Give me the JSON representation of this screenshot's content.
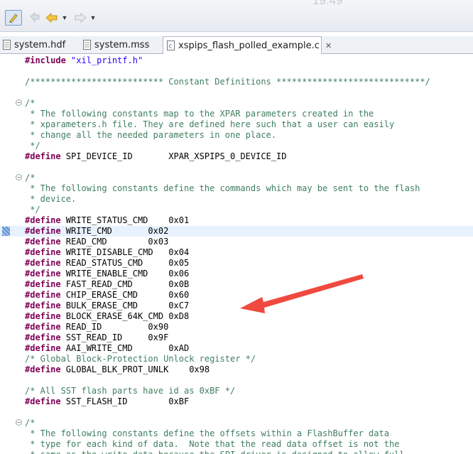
{
  "clock_text": "19:49",
  "toolbar": {
    "items": [
      {
        "icon": "pen-edit-icon",
        "pressed": true
      },
      {
        "icon": "prev-edit-location-icon"
      },
      {
        "icon": "back-arrow-icon",
        "color": "#e2a100"
      },
      {
        "icon": "dropdown-icon"
      },
      {
        "icon": "forward-arrow-icon"
      },
      {
        "icon": "dropdown-icon"
      }
    ]
  },
  "tabs": [
    {
      "label": "system.hdf",
      "icon": "file-icon",
      "active": false
    },
    {
      "label": "system.mss",
      "icon": "file-icon",
      "active": false
    },
    {
      "label": "xspips_flash_polled_example.c",
      "icon": "c-file-icon",
      "active": true,
      "close": "✕"
    }
  ],
  "code": [
    [
      {
        "t": "#include ",
        "c": "kw"
      },
      {
        "t": "\"xil_printf.h\"",
        "c": "str"
      }
    ],
    [],
    [
      {
        "t": "/************************** Constant Definitions *****************************/",
        "c": "cmt"
      }
    ],
    [],
    [
      {
        "t": "/*",
        "c": "cmt"
      }
    ],
    [
      {
        "t": " * The following constants map to the XPAR parameters created in the",
        "c": "cmt"
      }
    ],
    [
      {
        "t": " * xparameters.h file. They are defined here such that a user can easily",
        "c": "cmt"
      }
    ],
    [
      {
        "t": " * change all the needed parameters in one place.",
        "c": "cmt"
      }
    ],
    [
      {
        "t": " */",
        "c": "cmt"
      }
    ],
    [
      {
        "t": "#define ",
        "c": "kw"
      },
      {
        "t": "SPI_DEVICE_ID       XPAR_XSPIPS_0_DEVICE_ID"
      }
    ],
    [],
    [
      {
        "t": "/*",
        "c": "cmt"
      }
    ],
    [
      {
        "t": " * The following constants define the commands which may be sent to the flash",
        "c": "cmt"
      }
    ],
    [
      {
        "t": " * device.",
        "c": "cmt"
      }
    ],
    [
      {
        "t": " */",
        "c": "cmt"
      }
    ],
    [
      {
        "t": "#define ",
        "c": "kw"
      },
      {
        "t": "WRITE_STATUS_CMD    0x01"
      }
    ],
    [
      {
        "t": "#define ",
        "c": "kw"
      },
      {
        "t": "WRITE_CMD       0x02"
      }
    ],
    [
      {
        "t": "#define ",
        "c": "kw"
      },
      {
        "t": "READ_CMD        0x03"
      }
    ],
    [
      {
        "t": "#define ",
        "c": "kw"
      },
      {
        "t": "WRITE_DISABLE_CMD   0x04"
      }
    ],
    [
      {
        "t": "#define ",
        "c": "kw"
      },
      {
        "t": "READ_STATUS_CMD     0x05"
      }
    ],
    [
      {
        "t": "#define ",
        "c": "kw"
      },
      {
        "t": "WRITE_ENABLE_CMD    0x06"
      }
    ],
    [
      {
        "t": "#define ",
        "c": "kw"
      },
      {
        "t": "FAST_READ_CMD       0x0B"
      }
    ],
    [
      {
        "t": "#define ",
        "c": "kw"
      },
      {
        "t": "CHIP_ERASE_CMD      0x60"
      }
    ],
    [
      {
        "t": "#define ",
        "c": "kw"
      },
      {
        "t": "BULK_ERASE_CMD      0xC7"
      }
    ],
    [
      {
        "t": "#define ",
        "c": "kw"
      },
      {
        "t": "BLOCK_ERASE_64K_CMD 0xD8"
      }
    ],
    [
      {
        "t": "#define ",
        "c": "kw"
      },
      {
        "t": "READ_ID         0x90"
      }
    ],
    [
      {
        "t": "#define ",
        "c": "kw"
      },
      {
        "t": "SST_READ_ID     0x9F"
      }
    ],
    [
      {
        "t": "#define ",
        "c": "kw"
      },
      {
        "t": "AAI_WRITE_CMD       0xAD"
      }
    ],
    [
      {
        "t": "/* Global Block-Protection Unlock register */",
        "c": "cmt"
      }
    ],
    [
      {
        "t": "#define ",
        "c": "kw"
      },
      {
        "t": "GLOBAL_BLK_PROT_UNLK    0x98"
      }
    ],
    [],
    [
      {
        "t": "/* All SST flash parts have id as 0xBF */",
        "c": "cmt"
      }
    ],
    [
      {
        "t": "#define ",
        "c": "kw"
      },
      {
        "t": "SST_FLASH_ID        0xBF"
      }
    ],
    [],
    [
      {
        "t": "/*",
        "c": "cmt"
      }
    ],
    [
      {
        "t": " * The following constants define the offsets within a FlashBuffer data",
        "c": "cmt"
      }
    ],
    [
      {
        "t": " * type for each kind of data.  Note that the read data offset is not the",
        "c": "cmt"
      }
    ],
    [
      {
        "t": " * same as the write data because the SPI driver is designed to allow full",
        "c": "cmt"
      }
    ]
  ],
  "folds": [
    4,
    11,
    34
  ],
  "current_line": 16,
  "colors": {
    "keyword": "#7f0055",
    "string": "#2a00ff",
    "comment": "#3f7f5f",
    "current_line": "#e8f2fe",
    "arrow": "#f0493f"
  }
}
